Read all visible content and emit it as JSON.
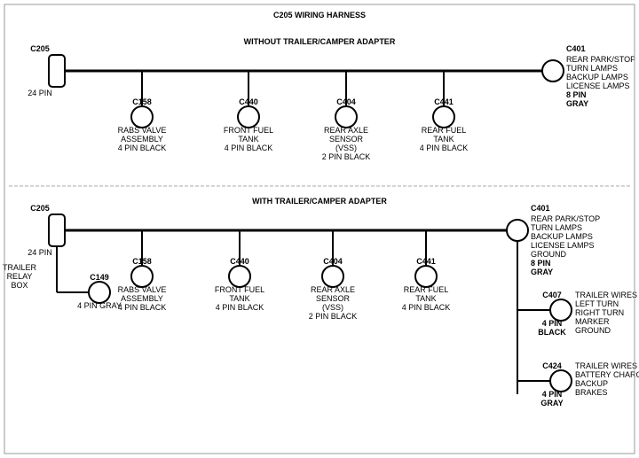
{
  "title": "C205 WIRING HARNESS",
  "diagram": {
    "top_section": {
      "label": "WITHOUT TRAILER/CAMPER ADAPTER",
      "left_connector": {
        "id": "C205",
        "pins": "24 PIN"
      },
      "right_connector": {
        "id": "C401",
        "pins": "8 PIN",
        "color": "GRAY",
        "label": "REAR PARK/STOP\nTURN LAMPS\nBACKUP LAMPS\nLICENSE LAMPS"
      },
      "connectors": [
        {
          "id": "C158",
          "label": "RABS VALVE\nASSEMBLY\n4 PIN BLACK"
        },
        {
          "id": "C440",
          "label": "FRONT FUEL\nTANK\n4 PIN BLACK"
        },
        {
          "id": "C404",
          "label": "REAR AXLE\nSENSOR\n(VSS)\n2 PIN BLACK"
        },
        {
          "id": "C441",
          "label": "REAR FUEL\nTANK\n4 PIN BLACK"
        }
      ]
    },
    "bottom_section": {
      "label": "WITH TRAILER/CAMPER ADAPTER",
      "left_connector": {
        "id": "C205",
        "pins": "24 PIN"
      },
      "right_connector": {
        "id": "C401",
        "pins": "8 PIN",
        "color": "GRAY",
        "label": "REAR PARK/STOP\nTURN LAMPS\nBACKUP LAMPS\nLICENSE LAMPS\nGROUND"
      },
      "extra_connector": {
        "id": "C149",
        "pins": "4 PIN GRAY",
        "label": "TRAILER\nRELAY\nBOX"
      },
      "connectors": [
        {
          "id": "C158",
          "label": "RABS VALVE\nASSEMBLY\n4 PIN BLACK"
        },
        {
          "id": "C440",
          "label": "FRONT FUEL\nTANK\n4 PIN BLACK"
        },
        {
          "id": "C404",
          "label": "REAR AXLE\nSENSOR\n(VSS)\n2 PIN BLACK"
        },
        {
          "id": "C441",
          "label": "REAR FUEL\nTANK\n4 PIN BLACK"
        }
      ],
      "right_extra": [
        {
          "id": "C407",
          "pins": "4 PIN\nBLACK",
          "label": "TRAILER WIRES\nLEFT TURN\nRIGHT TURN\nMARKER\nGROUND"
        },
        {
          "id": "C424",
          "pins": "4 PIN\nGRAY",
          "label": "TRAILER WIRES\nBATTERY CHARGE\nBACKUP\nBRAKES"
        }
      ]
    }
  }
}
